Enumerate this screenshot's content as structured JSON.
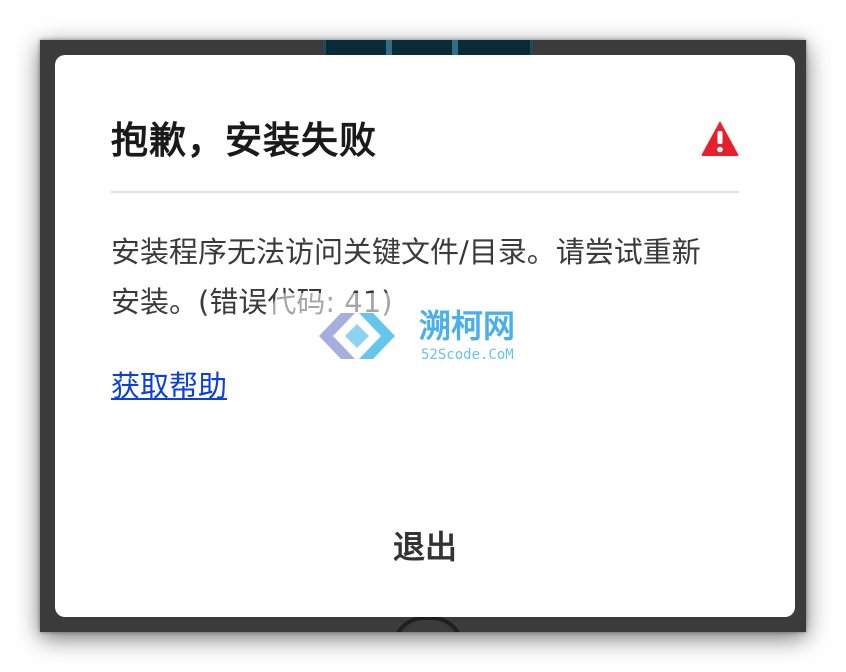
{
  "dialog": {
    "title": "抱歉，安装失败",
    "message": "安装程序无法访问关键文件/目录。请尝试重新安装。(错误代码: 41)",
    "help_link": "获取帮助",
    "exit_label": "退出",
    "warning_icon": "warning-triangle-icon",
    "warning_color": "#e8202e",
    "link_color": "#0a3fe0"
  },
  "watermark": {
    "logo": "watermark-logo-icon",
    "name": "溯柯网",
    "site": "52Scode.CoM"
  }
}
